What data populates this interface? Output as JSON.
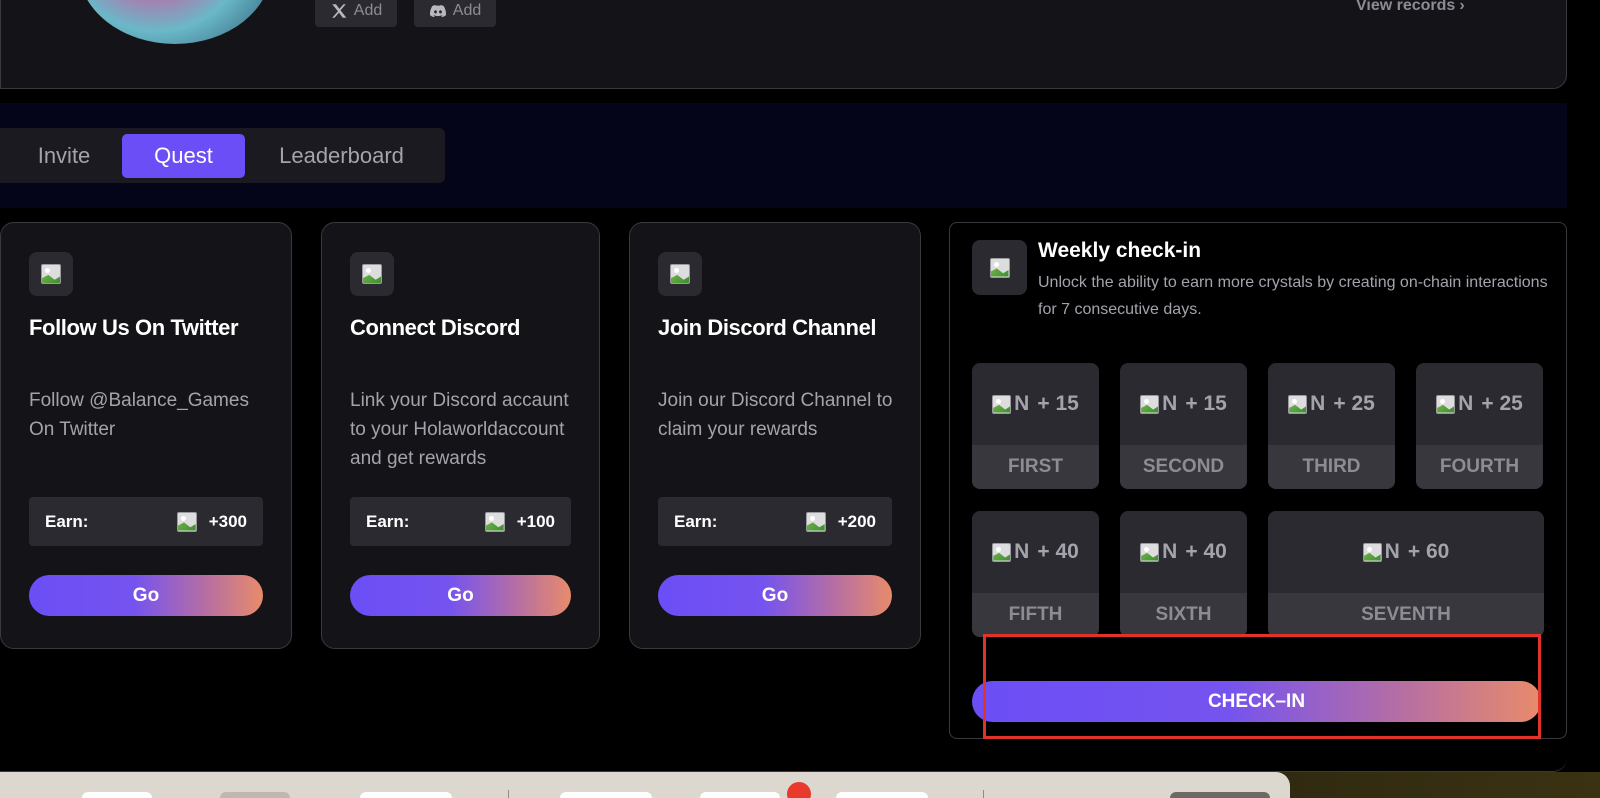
{
  "profile": {
    "social": [
      {
        "icon": "x-logo-icon",
        "label": "Add"
      },
      {
        "icon": "discord-logo-icon",
        "label": "Add"
      }
    ],
    "view_records": "View records"
  },
  "tabs": [
    {
      "label": "Invite",
      "active": false
    },
    {
      "label": "Quest",
      "active": true
    },
    {
      "label": "Leaderboard",
      "active": false
    }
  ],
  "quests": [
    {
      "title": "Follow Us On Twitter",
      "description": "Follow @Balance_Games On Twitter",
      "earn_label": "Earn:",
      "earn_value": "+300",
      "button": "Go"
    },
    {
      "title": "Connect Discord",
      "description": "Link your Discord accaunt to your Holaworldaccount and get rewards",
      "earn_label": "Earn:",
      "earn_value": "+100",
      "button": "Go"
    },
    {
      "title": "Join Discord Channel",
      "description": "Join our Discord Channel to claim your rewards",
      "earn_label": "Earn:",
      "earn_value": "+200",
      "button": "Go"
    }
  ],
  "weekly": {
    "title": "Weekly check-in",
    "description": "Unlock the ability to earn more crystals by creating on-chain interactions for 7 consecutive days.",
    "img_alt": "N",
    "days": [
      {
        "reward": "+ 15",
        "label": "FIRST"
      },
      {
        "reward": "+ 15",
        "label": "SECOND"
      },
      {
        "reward": "+ 25",
        "label": "THIRD"
      },
      {
        "reward": "+ 25",
        "label": "FOURTH"
      },
      {
        "reward": "+ 40",
        "label": "FIFTH"
      },
      {
        "reward": "+ 40",
        "label": "SIXTH"
      },
      {
        "reward": "+ 60",
        "label": "SEVENTH"
      }
    ],
    "button": "CHECK–IN"
  },
  "colors": {
    "accent": "#6b4ef6",
    "gradient_end": "#e88b6b",
    "highlight": "#e0332a"
  }
}
